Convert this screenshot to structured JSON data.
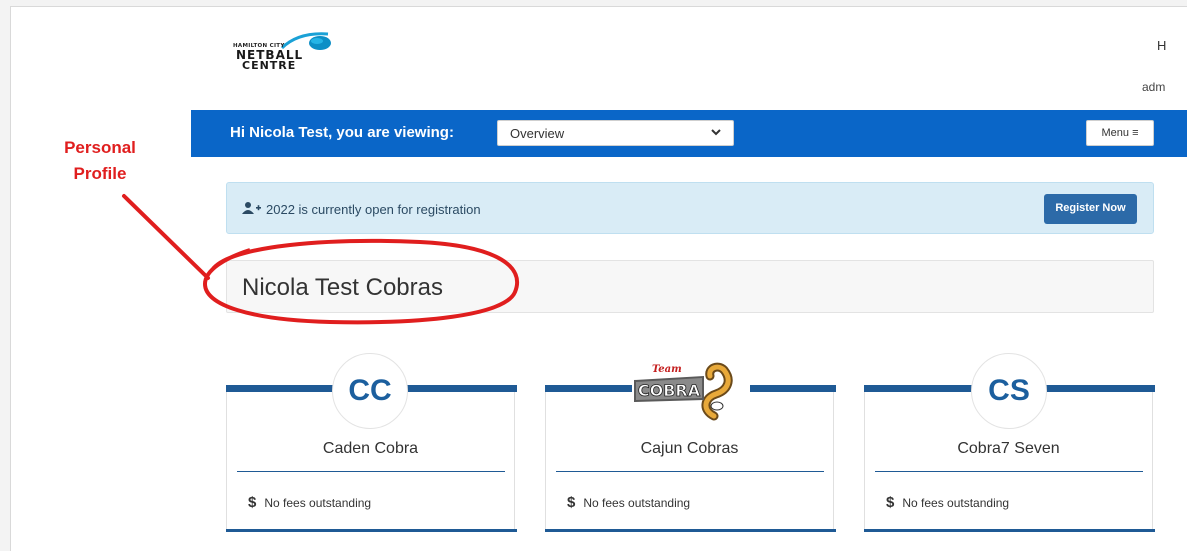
{
  "header": {
    "logo": {
      "line1": "HAMILTON CITY",
      "line2": "NETBALL",
      "line3": "CENTRE"
    },
    "top_right_h": "H",
    "top_right_admin": "adm"
  },
  "navbar": {
    "greeting": "Hi Nicola Test, you are viewing:",
    "viewing_select": "Overview",
    "menu_label": "Menu ≡"
  },
  "alert": {
    "text": "2022 is currently open for registration",
    "button": "Register Now"
  },
  "profile": {
    "name": "Nicola Test Cobras"
  },
  "annotation": {
    "line1": "Personal",
    "line2": "Profile"
  },
  "cards": [
    {
      "initials": "CC",
      "title": "Caden Cobra",
      "fee": "No fees outstanding"
    },
    {
      "logo_text": "COBRA",
      "logo_small": "Team",
      "title": "Cajun Cobras",
      "fee": "No fees outstanding"
    },
    {
      "initials": "CS",
      "title": "Cobra7 Seven",
      "fee": "No fees outstanding"
    }
  ],
  "colors": {
    "nav": "#0a66c8",
    "accent": "#1f5a95",
    "annotation": "#e01e1e"
  }
}
